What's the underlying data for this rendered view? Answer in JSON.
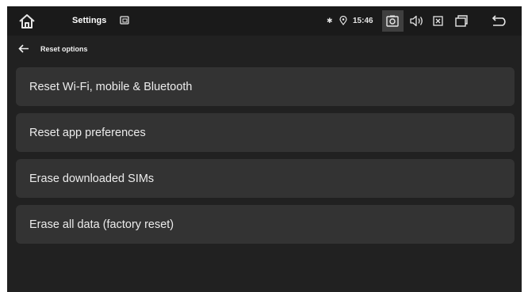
{
  "status_bar": {
    "app_title": "Settings",
    "bluetooth_glyph": "✱",
    "time": "15:46",
    "icons": [
      "home-icon",
      "cast-icon",
      "bluetooth-icon",
      "location-icon",
      "screenshot-icon",
      "volume-icon",
      "close-box-icon",
      "recents-icon",
      "back-icon"
    ]
  },
  "header": {
    "title": "Reset options"
  },
  "list": {
    "items": [
      {
        "label": "Reset Wi-Fi, mobile & Bluetooth"
      },
      {
        "label": "Reset app preferences"
      },
      {
        "label": "Erase downloaded SIMs"
      },
      {
        "label": "Erase all data (factory reset)"
      }
    ]
  },
  "colors": {
    "background": "#212121",
    "status_bar": "#1a1a1a",
    "item_background": "#333333",
    "text": "#ececec"
  }
}
